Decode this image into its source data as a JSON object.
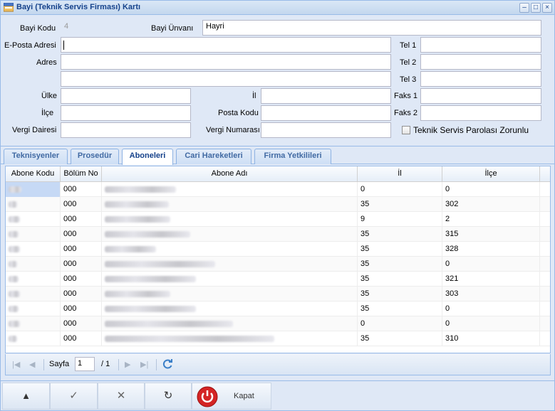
{
  "window": {
    "title": "Bayi (Teknik Servis Firması) Kartı"
  },
  "form": {
    "bayi_kodu_label": "Bayi Kodu",
    "bayi_kodu_value": "4",
    "bayi_unvani_label": "Bayi Ünvanı",
    "bayi_unvani_value": "Hayri",
    "eposta_label": "E-Posta Adresi",
    "adres_label": "Adres",
    "tel1_label": "Tel 1",
    "tel2_label": "Tel 2",
    "tel3_label": "Tel 3",
    "faks1_label": "Faks 1",
    "faks2_label": "Faks 2",
    "ulke_label": "Ülke",
    "il_label": "İl",
    "ilce_label": "İlçe",
    "posta_kodu_label": "Posta Kodu",
    "vergi_dairesi_label": "Vergi Dairesi",
    "vergi_numarasi_label": "Vergi Numarası",
    "parola_checkbox_label": "Teknik Servis Parolası Zorunlu"
  },
  "tabs": [
    {
      "label": "Teknisyenler"
    },
    {
      "label": "Prosedür"
    },
    {
      "label": "Aboneleri"
    },
    {
      "label": "Cari Hareketleri"
    },
    {
      "label": "Firma Yetkilileri"
    }
  ],
  "grid": {
    "columns": [
      "Abone Kodu",
      "Bölüm No",
      "Abone Adı",
      "İl",
      "İlçe"
    ],
    "rows": [
      {
        "bolum": "000",
        "il": "0",
        "ilce": "0"
      },
      {
        "bolum": "000",
        "il": "35",
        "ilce": "302"
      },
      {
        "bolum": "000",
        "il": "9",
        "ilce": "2"
      },
      {
        "bolum": "000",
        "il": "35",
        "ilce": "315"
      },
      {
        "bolum": "000",
        "il": "35",
        "ilce": "328"
      },
      {
        "bolum": "000",
        "il": "35",
        "ilce": "0"
      },
      {
        "bolum": "000",
        "il": "35",
        "ilce": "321"
      },
      {
        "bolum": "000",
        "il": "35",
        "ilce": "303"
      },
      {
        "bolum": "000",
        "il": "35",
        "ilce": "0"
      },
      {
        "bolum": "000",
        "il": "0",
        "ilce": "0"
      },
      {
        "bolum": "000",
        "il": "35",
        "ilce": "310"
      }
    ]
  },
  "pager": {
    "page_label": "Sayfa",
    "page_value": "1",
    "of_label": "/ 1"
  },
  "buttons": {
    "close_label": "Kapat"
  }
}
